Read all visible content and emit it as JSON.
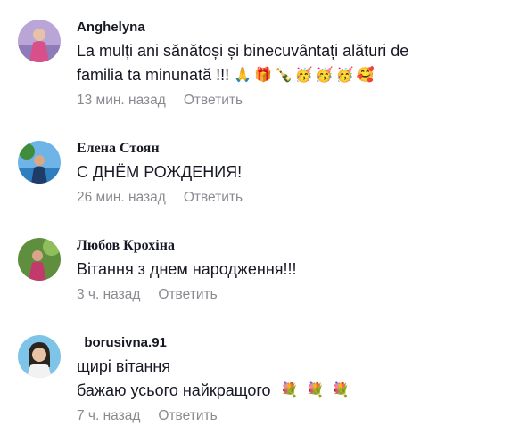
{
  "comments": [
    {
      "author": "Anghelyna",
      "lines": [
        "La mulți ani sănătoși și binecuvântați alături de",
        "familia ta minunată !!!"
      ],
      "emojis": [
        "🙏",
        "🎁",
        "🍾",
        "🥳",
        "🥳",
        "🥳",
        "🥰"
      ],
      "time": "13 мин. назад",
      "reply": "Ответить"
    },
    {
      "author": "Елена Стоян",
      "lines": [
        "С ДНЁМ РОЖДЕНИЯ!"
      ],
      "time": "26 мин. назад",
      "reply": "Ответить"
    },
    {
      "author": "Любов Крохіна",
      "lines": [
        "Вітання з днем народження!!!"
      ],
      "time": "3 ч. назад",
      "reply": "Ответить"
    },
    {
      "author": "_borusivna.91",
      "lines": [
        "щирі вітання",
        "бажаю усього найкращого"
      ],
      "emojis": [
        "💐",
        "💐",
        "💐"
      ],
      "time": "7 ч. назад",
      "reply": "Ответить"
    }
  ]
}
